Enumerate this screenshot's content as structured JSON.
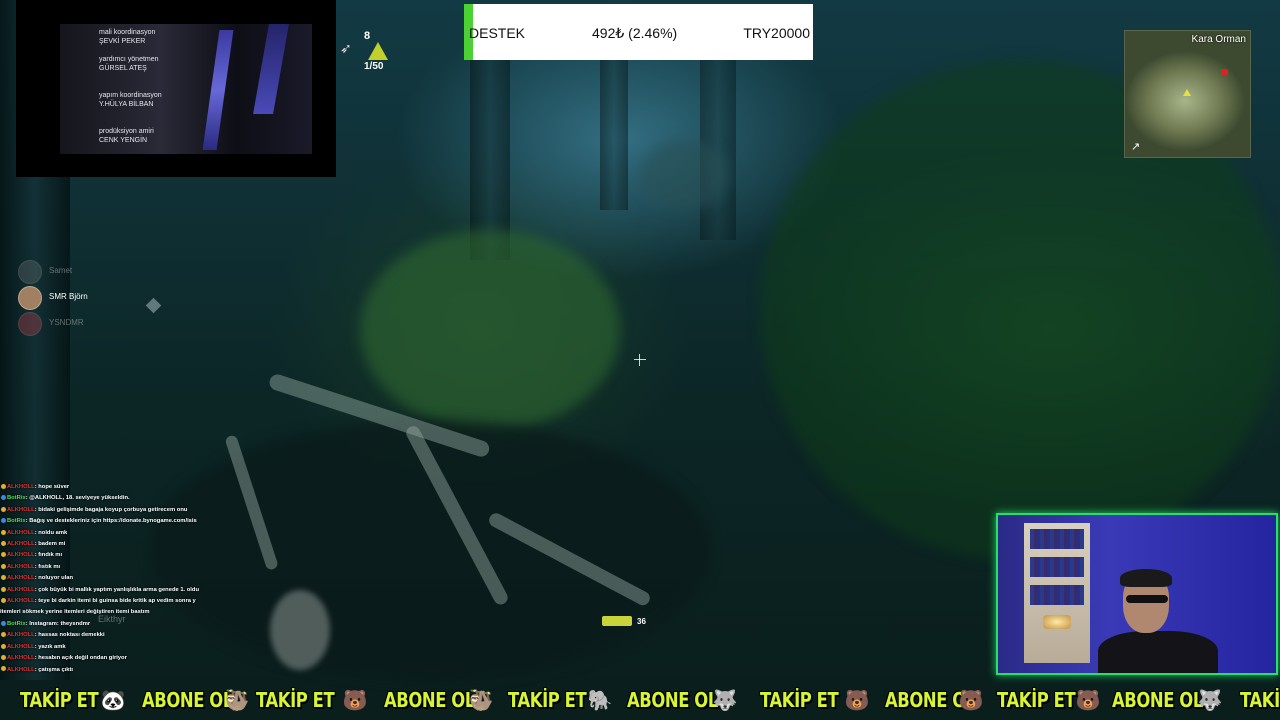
{
  "credits": [
    {
      "role": "mali koordinasyon",
      "name": "ŞEVKİ PEKER"
    },
    {
      "role": "yardımcı yönetmen",
      "name": "GÜRSEL ATEŞ"
    },
    {
      "role": "yapım koordinasyon",
      "name": "Y.HÜLYA BİLBAN"
    },
    {
      "role": "prodüksiyon amiri",
      "name": "CENK YENGİN"
    }
  ],
  "ammo_hud": {
    "count": "8",
    "capacity": "1/50",
    "icon": "bow-icon"
  },
  "donation": {
    "label": "DESTEK",
    "amount": "492₺ (2.46%)",
    "goal": "TRY20000",
    "progress_percent": 2.46,
    "fill_color": "#4cd134"
  },
  "minimap": {
    "title": "Kara Orman",
    "nav_icon": "expand-arrow-icon"
  },
  "party": [
    {
      "name": "Samet",
      "active": false
    },
    {
      "name": "SMR Björn",
      "active": true
    },
    {
      "name": "YSNDMR",
      "active": false
    }
  ],
  "chat": [
    {
      "user": "ALKHOLL",
      "msg": ": hope süver",
      "color": "#e23232"
    },
    {
      "user": "BotRix",
      "msg": ": @ALKHOLL, 18. seviyeye yükseldin.",
      "color": "#4ee04e"
    },
    {
      "user": "ALKHOLL",
      "msg": ": bidaki gelişimde bagaja koyup çorbuya getirecem onu",
      "color": "#e23232"
    },
    {
      "user": "BotRix",
      "msg": ": Bağış ve destekleriniz için https://donate.bynogame.com/isis",
      "color": "#4ee04e"
    },
    {
      "user": "ALKHOLL",
      "msg": ": noldu amk",
      "color": "#e23232"
    },
    {
      "user": "ALKHOLL",
      "msg": ": badem mi",
      "color": "#e23232"
    },
    {
      "user": "ALKHOLL",
      "msg": ": fındık mı",
      "color": "#e23232"
    },
    {
      "user": "ALKHOLL",
      "msg": ": fıstık mı",
      "color": "#e23232"
    },
    {
      "user": "ALKHOLL",
      "msg": ": noluyor ulan",
      "color": "#e23232"
    },
    {
      "user": "ALKHOLL",
      "msg": ": çok büyük bi mallık yaptım yanlışlıkla arma genede 1. oldu",
      "color": "#e23232"
    },
    {
      "user": "ALKHOLL",
      "msg": ": teye bi darkin itemi bi guinsa bide kritik ap vedim sonra y",
      "color": "#e23232"
    },
    {
      "user": "",
      "msg": "itemleri sökmek yerine itemleri değiştiren itemi bastım",
      "color": "#ffffff"
    },
    {
      "user": "BotRix",
      "msg": ": Instagram: theysndmr",
      "color": "#4ee04e"
    },
    {
      "user": "ALKHOLL",
      "msg": ": hassas noktası demekki",
      "color": "#e23232"
    },
    {
      "user": "ALKHOLL",
      "msg": ": yazık amk",
      "color": "#e23232"
    },
    {
      "user": "ALKHOLL",
      "msg": ": hesabın açık değil ondan giriyor",
      "color": "#e23232"
    },
    {
      "user": "ALKHOLL",
      "msg": ": çatışma çıktı",
      "color": "#e23232"
    }
  ],
  "stamina": {
    "value": "36"
  },
  "ghost_names": [
    "Eikthyr"
  ],
  "ticker": [
    {
      "text": "TAKİP ET",
      "animal": "panda-icon"
    },
    {
      "text": "ABONE OL",
      "animal": "sloth-icon"
    },
    {
      "text": "TAKİP ET",
      "animal": "bear-icon"
    },
    {
      "text": "ABONE OL",
      "animal": "sloth-icon"
    },
    {
      "text": "TAKİP ET",
      "animal": "elephant-icon"
    },
    {
      "text": "ABONE OL",
      "animal": "wolf-icon"
    },
    {
      "text": "TAKİP ET",
      "animal": "bear-icon"
    },
    {
      "text": "ABONE OL",
      "animal": "bear-icon"
    },
    {
      "text": "TAKİP ET",
      "animal": "bear-icon"
    },
    {
      "text": "ABONE OL",
      "animal": "wolf-icon"
    },
    {
      "text": "TAKİP"
    }
  ]
}
